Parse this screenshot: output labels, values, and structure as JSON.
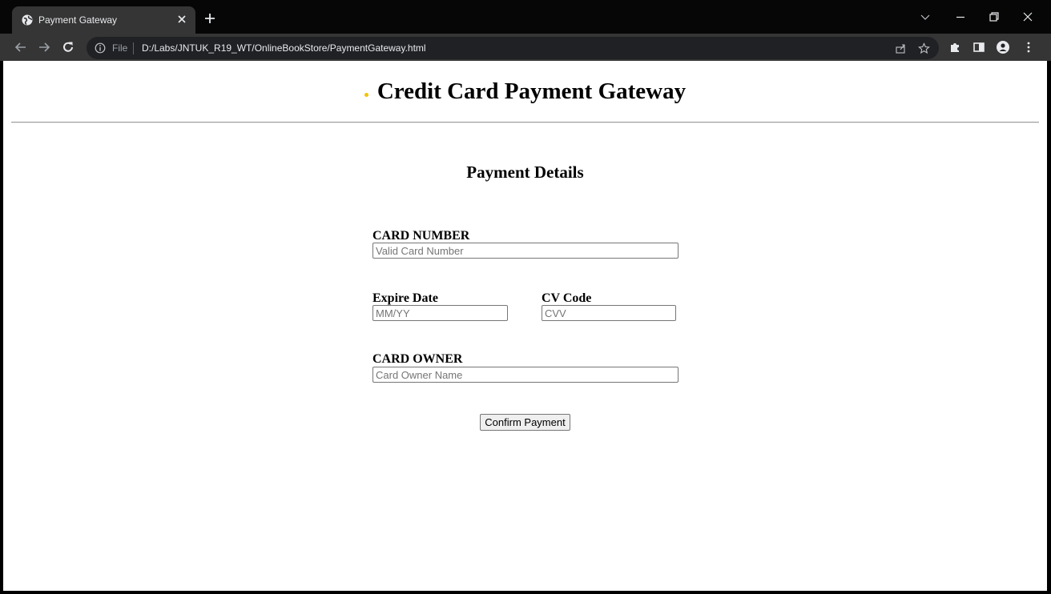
{
  "browser": {
    "tab_title": "Payment Gateway",
    "url_scheme": "File",
    "url": "D:/Labs/JNTUK_R19_WT/OnlineBookStore/PaymentGateway.html"
  },
  "page": {
    "heading": "Credit Card Payment Gateway",
    "section_title": "Payment Details",
    "fields": {
      "card_number": {
        "label": "CARD NUMBER",
        "placeholder": "Valid Card Number",
        "value": ""
      },
      "expire_date": {
        "label": "Expire Date",
        "placeholder": "MM/YY",
        "value": ""
      },
      "cv_code": {
        "label": "CV Code",
        "placeholder": "CVV",
        "value": ""
      },
      "card_owner": {
        "label": "CARD OWNER",
        "placeholder": "Card Owner Name",
        "value": ""
      }
    },
    "submit_label": "Confirm Payment"
  },
  "colors": {
    "bullet": "#f2c200",
    "chrome_dark": "#060606",
    "chrome_toolbar": "#353535"
  }
}
